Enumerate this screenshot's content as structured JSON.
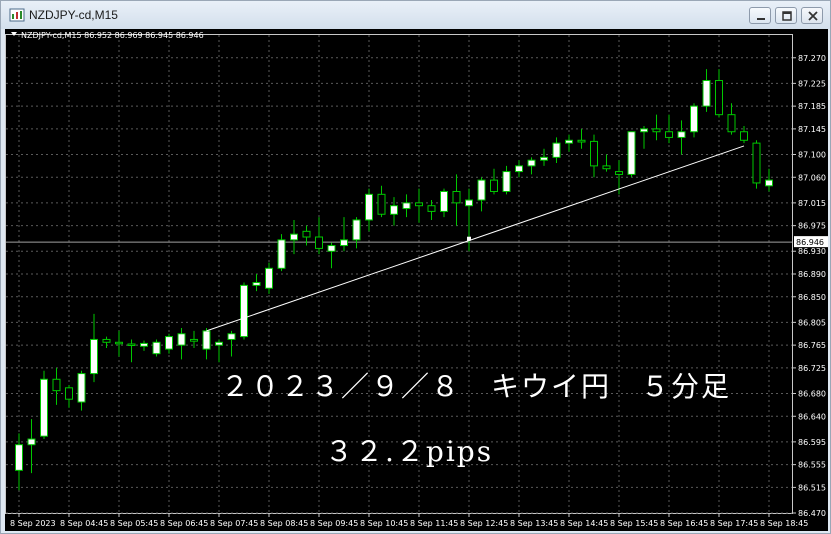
{
  "window": {
    "title": "NZDJPY-cd,M15",
    "buttons": {
      "minimize": "minimize-icon",
      "maximize": "maximize-icon",
      "close": "close-icon"
    }
  },
  "chart_header": "NZDJPY-cd,M15  86.952 86.969 86.945 86.946",
  "annotation": {
    "title": "２０２３／９／８　キウイ円　５分足",
    "pips": "３２.２pips"
  },
  "colors": {
    "background": "#000000",
    "grid": "#5a5a5a",
    "bull_body": "#ffffff",
    "bear_body": "#000000",
    "wick": "#00c800",
    "trendline": "#ffffff",
    "price_line": "#a0a0a0"
  },
  "chart_data": {
    "type": "candlestick",
    "symbol": "NZDJPY-cd",
    "timeframe": "M15",
    "current_price": "86.946",
    "ylim": [
      86.47,
      87.31
    ],
    "y_ticks": [
      "87.270",
      "87.225",
      "87.185",
      "87.145",
      "87.100",
      "87.060",
      "87.015",
      "86.975",
      "86.930",
      "86.890",
      "86.850",
      "86.805",
      "86.765",
      "86.725",
      "86.680",
      "86.640",
      "86.595",
      "86.555",
      "86.515",
      "86.470"
    ],
    "y_tick_values": [
      87.27,
      87.225,
      87.185,
      87.145,
      87.1,
      87.06,
      87.015,
      86.975,
      86.93,
      86.89,
      86.85,
      86.805,
      86.765,
      86.725,
      86.68,
      86.64,
      86.595,
      86.555,
      86.515,
      86.47
    ],
    "x_ticks": [
      "8 Sep 2023",
      "8 Sep 04:45",
      "8 Sep 05:45",
      "8 Sep 06:45",
      "8 Sep 07:45",
      "8 Sep 08:45",
      "8 Sep 09:45",
      "8 Sep 10:45",
      "8 Sep 11:45",
      "8 Sep 12:45",
      "8 Sep 13:45",
      "8 Sep 14:45",
      "8 Sep 15:45",
      "8 Sep 16:45",
      "8 Sep 17:45",
      "8 Sep 18:45"
    ],
    "x_tick_bar_index": [
      0,
      4,
      8,
      12,
      16,
      20,
      24,
      28,
      32,
      36,
      40,
      44,
      48,
      52,
      56,
      60
    ],
    "candles": [
      {
        "o": 86.545,
        "h": 86.61,
        "l": 86.51,
        "c": 86.59
      },
      {
        "o": 86.59,
        "h": 86.635,
        "l": 86.54,
        "c": 86.6
      },
      {
        "o": 86.605,
        "h": 86.72,
        "l": 86.6,
        "c": 86.705
      },
      {
        "o": 86.705,
        "h": 86.725,
        "l": 86.66,
        "c": 86.685
      },
      {
        "o": 86.69,
        "h": 86.695,
        "l": 86.655,
        "c": 86.67
      },
      {
        "o": 86.665,
        "h": 86.72,
        "l": 86.65,
        "c": 86.715
      },
      {
        "o": 86.715,
        "h": 86.82,
        "l": 86.7,
        "c": 86.775
      },
      {
        "o": 86.775,
        "h": 86.78,
        "l": 86.76,
        "c": 86.77
      },
      {
        "o": 86.77,
        "h": 86.79,
        "l": 86.745,
        "c": 86.768
      },
      {
        "o": 86.767,
        "h": 86.775,
        "l": 86.735,
        "c": 86.765
      },
      {
        "o": 86.763,
        "h": 86.773,
        "l": 86.755,
        "c": 86.768
      },
      {
        "o": 86.75,
        "h": 86.775,
        "l": 86.745,
        "c": 86.77
      },
      {
        "o": 86.758,
        "h": 86.785,
        "l": 86.75,
        "c": 86.78
      },
      {
        "o": 86.765,
        "h": 86.795,
        "l": 86.74,
        "c": 86.785
      },
      {
        "o": 86.775,
        "h": 86.79,
        "l": 86.76,
        "c": 86.772
      },
      {
        "o": 86.758,
        "h": 86.795,
        "l": 86.74,
        "c": 86.79
      },
      {
        "o": 86.765,
        "h": 86.775,
        "l": 86.735,
        "c": 86.77
      },
      {
        "o": 86.775,
        "h": 86.79,
        "l": 86.745,
        "c": 86.785
      },
      {
        "o": 86.78,
        "h": 86.875,
        "l": 86.775,
        "c": 86.87
      },
      {
        "o": 86.87,
        "h": 86.89,
        "l": 86.86,
        "c": 86.875
      },
      {
        "o": 86.865,
        "h": 86.91,
        "l": 86.855,
        "c": 86.9
      },
      {
        "o": 86.9,
        "h": 86.96,
        "l": 86.895,
        "c": 86.95
      },
      {
        "o": 86.95,
        "h": 86.985,
        "l": 86.925,
        "c": 86.96
      },
      {
        "o": 86.965,
        "h": 86.975,
        "l": 86.94,
        "c": 86.955
      },
      {
        "o": 86.955,
        "h": 86.99,
        "l": 86.925,
        "c": 86.935
      },
      {
        "o": 86.93,
        "h": 86.945,
        "l": 86.9,
        "c": 86.94
      },
      {
        "o": 86.94,
        "h": 86.99,
        "l": 86.93,
        "c": 86.95
      },
      {
        "o": 86.95,
        "h": 86.99,
        "l": 86.935,
        "c": 86.985
      },
      {
        "o": 86.985,
        "h": 87.04,
        "l": 86.965,
        "c": 87.03
      },
      {
        "o": 87.03,
        "h": 87.045,
        "l": 86.99,
        "c": 86.995
      },
      {
        "o": 86.995,
        "h": 87.025,
        "l": 86.975,
        "c": 87.01
      },
      {
        "o": 87.005,
        "h": 87.03,
        "l": 86.99,
        "c": 87.015
      },
      {
        "o": 87.015,
        "h": 87.04,
        "l": 86.98,
        "c": 87.01
      },
      {
        "o": 87.01,
        "h": 87.02,
        "l": 86.985,
        "c": 87.0
      },
      {
        "o": 87.0,
        "h": 87.04,
        "l": 86.99,
        "c": 87.035
      },
      {
        "o": 87.035,
        "h": 87.065,
        "l": 86.975,
        "c": 87.015
      },
      {
        "o": 87.01,
        "h": 87.04,
        "l": 86.93,
        "c": 87.02
      },
      {
        "o": 87.02,
        "h": 87.06,
        "l": 87.0,
        "c": 87.055
      },
      {
        "o": 87.055,
        "h": 87.075,
        "l": 87.03,
        "c": 87.035
      },
      {
        "o": 87.035,
        "h": 87.08,
        "l": 87.03,
        "c": 87.07
      },
      {
        "o": 87.07,
        "h": 87.09,
        "l": 87.06,
        "c": 87.08
      },
      {
        "o": 87.08,
        "h": 87.095,
        "l": 87.065,
        "c": 87.09
      },
      {
        "o": 87.09,
        "h": 87.11,
        "l": 87.08,
        "c": 87.095
      },
      {
        "o": 87.095,
        "h": 87.13,
        "l": 87.085,
        "c": 87.12
      },
      {
        "o": 87.12,
        "h": 87.135,
        "l": 87.105,
        "c": 87.125
      },
      {
        "o": 87.125,
        "h": 87.145,
        "l": 87.11,
        "c": 87.122
      },
      {
        "o": 87.123,
        "h": 87.135,
        "l": 87.06,
        "c": 87.08
      },
      {
        "o": 87.08,
        "h": 87.1,
        "l": 87.07,
        "c": 87.075
      },
      {
        "o": 87.07,
        "h": 87.09,
        "l": 87.03,
        "c": 87.065
      },
      {
        "o": 87.065,
        "h": 87.13,
        "l": 87.06,
        "c": 87.14
      },
      {
        "o": 87.14,
        "h": 87.15,
        "l": 87.11,
        "c": 87.145
      },
      {
        "o": 87.145,
        "h": 87.17,
        "l": 87.125,
        "c": 87.14
      },
      {
        "o": 87.14,
        "h": 87.17,
        "l": 87.12,
        "c": 87.13
      },
      {
        "o": 87.13,
        "h": 87.16,
        "l": 87.1,
        "c": 87.14
      },
      {
        "o": 87.14,
        "h": 87.19,
        "l": 87.13,
        "c": 87.185
      },
      {
        "o": 87.185,
        "h": 87.25,
        "l": 87.175,
        "c": 87.23
      },
      {
        "o": 87.23,
        "h": 87.25,
        "l": 87.165,
        "c": 87.17
      },
      {
        "o": 87.17,
        "h": 87.19,
        "l": 87.135,
        "c": 87.14
      },
      {
        "o": 87.14,
        "h": 87.15,
        "l": 87.12,
        "c": 87.125
      },
      {
        "o": 87.12,
        "h": 87.125,
        "l": 87.04,
        "c": 87.05
      },
      {
        "o": 87.045,
        "h": 87.075,
        "l": 87.035,
        "c": 87.055
      }
    ],
    "trendline": {
      "from_bar": 15,
      "from_price": 86.79,
      "to_bar": 58,
      "to_price": 87.115,
      "midpoint_bar": 36,
      "midpoint_price": 86.952
    }
  }
}
